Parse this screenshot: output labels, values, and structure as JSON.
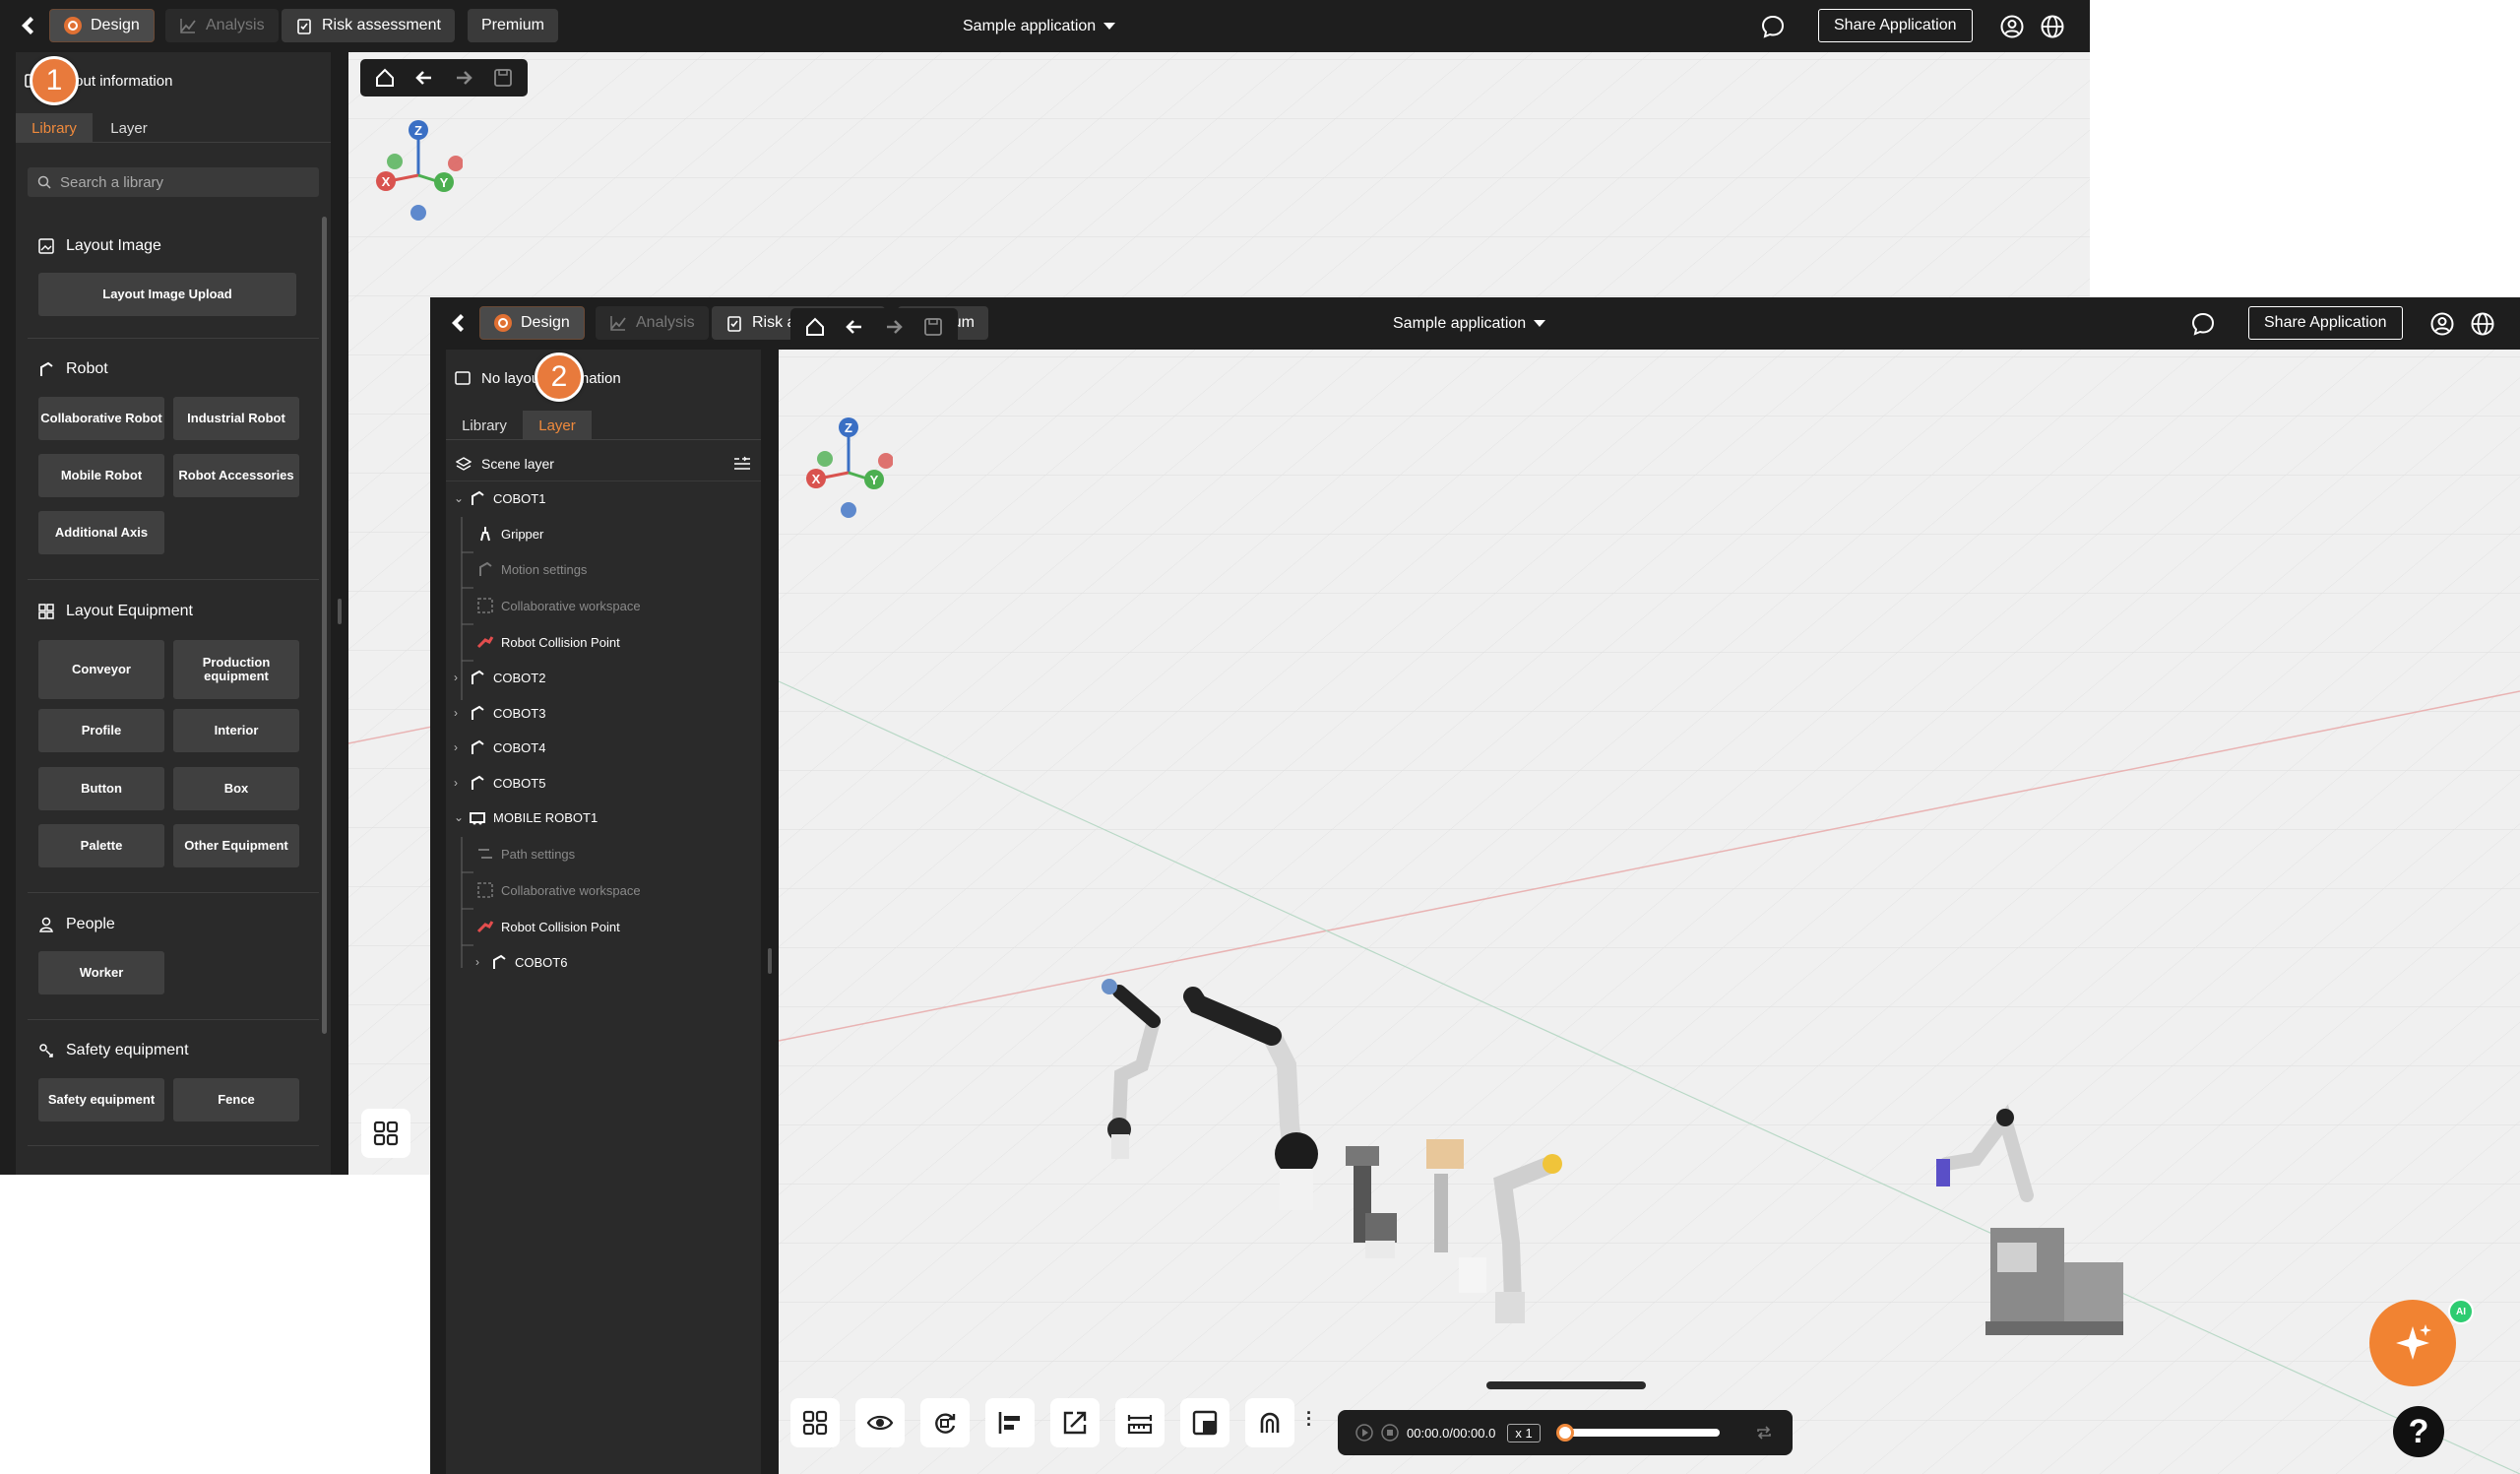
{
  "topbar": {
    "design_label": "Design",
    "analysis_label": "Analysis",
    "risk_label": "Risk assessment",
    "premium_label": "Premium",
    "app_name": "Sample application",
    "share_label": "Share Application"
  },
  "shot1": {
    "badge": "1",
    "info_label": "Layout information",
    "tabs": [
      "Library",
      "Layer"
    ],
    "active_tab": "Library",
    "search_placeholder": "Search a library",
    "sections": {
      "layout_image": {
        "title": "Layout Image",
        "buttons": [
          "Layout Image Upload"
        ]
      },
      "robot": {
        "title": "Robot",
        "buttons": [
          "Collaborative Robot",
          "Industrial Robot",
          "Mobile Robot",
          "Robot Accessories",
          "Additional Axis"
        ]
      },
      "layout_equipment": {
        "title": "Layout Equipment",
        "buttons": [
          "Conveyor",
          "Production equipment",
          "Profile",
          "Interior",
          "Button",
          "Box",
          "Palette",
          "Other Equipment"
        ]
      },
      "people": {
        "title": "People",
        "buttons": [
          "Worker"
        ]
      },
      "safety": {
        "title": "Safety equipment",
        "buttons": [
          "Safety equipment",
          "Fence"
        ]
      }
    }
  },
  "shot2": {
    "badge": "2",
    "info_label": "No layout information",
    "tabs": [
      "Library",
      "Layer"
    ],
    "active_tab": "Layer",
    "scene_layer_label": "Scene layer",
    "layers": [
      {
        "label": "COBOT1",
        "icon": "robot-arm-icon",
        "state": "expanded"
      },
      {
        "label": "Gripper",
        "icon": "gripper-icon"
      },
      {
        "label": "Motion settings",
        "icon": "motion-icon",
        "dim": true
      },
      {
        "label": "Collaborative workspace",
        "icon": "workspace-icon",
        "dim": true
      },
      {
        "label": "Robot Collision Point",
        "icon": "collision-icon"
      },
      {
        "label": "COBOT2",
        "icon": "robot-arm-icon",
        "state": "collapsed"
      },
      {
        "label": "COBOT3",
        "icon": "robot-arm-icon",
        "state": "collapsed"
      },
      {
        "label": "COBOT4",
        "icon": "robot-arm-icon",
        "state": "collapsed"
      },
      {
        "label": "COBOT5",
        "icon": "robot-arm-icon",
        "state": "collapsed"
      },
      {
        "label": "MOBILE ROBOT1",
        "icon": "mobile-robot-icon",
        "state": "expanded"
      },
      {
        "label": "Path settings",
        "icon": "path-icon",
        "dim": true
      },
      {
        "label": "Collaborative workspace",
        "icon": "workspace-icon",
        "dim": true
      },
      {
        "label": "Robot Collision Point",
        "icon": "collision-icon"
      },
      {
        "label": "COBOT6",
        "icon": "robot-arm-icon",
        "state": "collapsed"
      }
    ],
    "timeline": {
      "time": "00:00.0/00:00.0",
      "speed": "x 1",
      "progress": 0.02
    },
    "ai_badge": "AI",
    "help_label": "?"
  },
  "axes": {
    "z": "Z",
    "x": "X",
    "y": "Y"
  },
  "colors": {
    "accent": "#e87a3c",
    "topbar": "#1e1e1e",
    "panel": "#2a2a2a",
    "axis_x": "#d9534f",
    "axis_y": "#4caf50",
    "axis_z": "#3a6fc4"
  }
}
